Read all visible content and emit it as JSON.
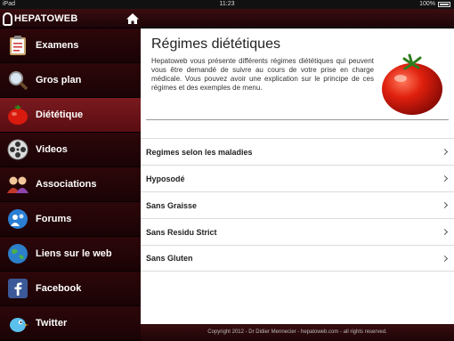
{
  "status_bar": {
    "device": "iPad",
    "time": "11:23",
    "battery": "100%"
  },
  "navbar": {
    "logo_text": "HEPATOWEB",
    "home_icon": "home-icon"
  },
  "sidebar": {
    "items": [
      {
        "label": "Examens",
        "icon": "clipboard-icon",
        "active": false
      },
      {
        "label": "Gros plan",
        "icon": "magnifier-icon",
        "active": false
      },
      {
        "label": "Diététique",
        "icon": "tomato-icon",
        "active": true
      },
      {
        "label": "Videos",
        "icon": "film-reel-icon",
        "active": false
      },
      {
        "label": "Associations",
        "icon": "people-icon",
        "active": false
      },
      {
        "label": "Forums",
        "icon": "forum-icon",
        "active": false
      },
      {
        "label": "Liens sur le web",
        "icon": "globe-icon",
        "active": false
      },
      {
        "label": "Facebook",
        "icon": "facebook-icon",
        "active": false
      },
      {
        "label": "Twitter",
        "icon": "twitter-icon",
        "active": false
      }
    ]
  },
  "main": {
    "title": "Régimes diététiques",
    "intro": "Hepatoweb vous présente différents régimes diététiques qui peuvent vous être demandé de suivre au cours de votre prise en charge médicale. Vous pouvez avoir une explication sur le principe de ces régimes et des exemples de menu.",
    "list": [
      "Regimes selon les maladies",
      "Hyposodé",
      "Sans Graisse",
      "Sans Residu Strict",
      "Sans Gluten"
    ]
  },
  "footer": {
    "text": "Copyright 2012 - Dr Didier Mennecier - hepatoweb.com - all rights reserved."
  },
  "colors": {
    "accent": "#7a1a1f",
    "sidebar_bg": "#1a0305"
  }
}
